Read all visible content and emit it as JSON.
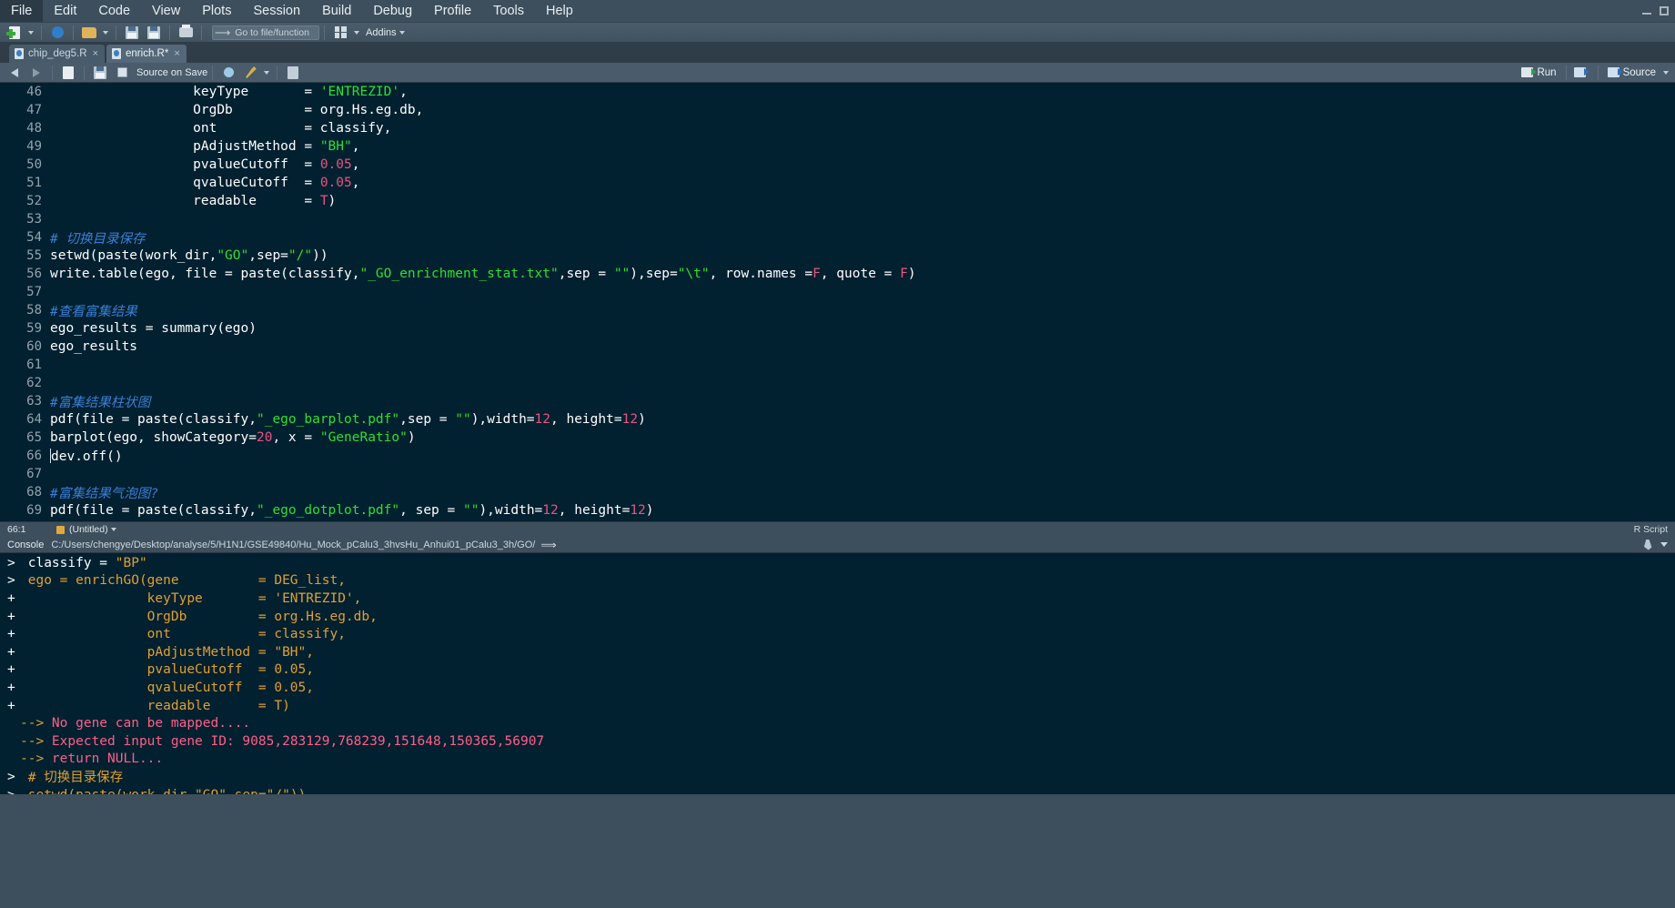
{
  "menubar": {
    "items": [
      {
        "label": "File",
        "active": true
      },
      {
        "label": "Edit",
        "active": false
      },
      {
        "label": "Code",
        "active": false
      },
      {
        "label": "View",
        "active": false
      },
      {
        "label": "Plots",
        "active": false
      },
      {
        "label": "Session",
        "active": false
      },
      {
        "label": "Build",
        "active": false
      },
      {
        "label": "Debug",
        "active": false
      },
      {
        "label": "Profile",
        "active": false
      },
      {
        "label": "Tools",
        "active": false
      },
      {
        "label": "Help",
        "active": false
      }
    ]
  },
  "global_toolbar": {
    "goto_placeholder": "Go to file/function",
    "addins_label": "Addins",
    "icons": [
      "new-file-icon",
      "new-project-icon",
      "open-file-icon",
      "save-icon",
      "save-all-icon",
      "print-icon",
      "workspace-panes-icon"
    ]
  },
  "source_tabs": [
    {
      "label": "chip_deg5.R",
      "active": false,
      "close": "×"
    },
    {
      "label": "enrich.R*",
      "active": true,
      "close": "×"
    }
  ],
  "editor_toolbar": {
    "source_on_save_label": "Source on Save",
    "run_label": "Run",
    "source_label": "Source"
  },
  "editor": {
    "lines": [
      {
        "num": "46",
        "segments": [
          {
            "t": "                  keyType       = ",
            "c": "plain"
          },
          {
            "t": "'ENTREZID'",
            "c": "str"
          },
          {
            "t": ",",
            "c": "plain"
          }
        ]
      },
      {
        "num": "47",
        "segments": [
          {
            "t": "                  OrgDb         = org.Hs.eg.db,",
            "c": "plain"
          }
        ]
      },
      {
        "num": "48",
        "segments": [
          {
            "t": "                  ont           = classify,",
            "c": "plain"
          }
        ]
      },
      {
        "num": "49",
        "segments": [
          {
            "t": "                  pAdjustMethod = ",
            "c": "plain"
          },
          {
            "t": "\"BH\"",
            "c": "str"
          },
          {
            "t": ",",
            "c": "plain"
          }
        ]
      },
      {
        "num": "50",
        "segments": [
          {
            "t": "                  pvalueCutoff  = ",
            "c": "plain"
          },
          {
            "t": "0.05",
            "c": "num"
          },
          {
            "t": ",",
            "c": "plain"
          }
        ]
      },
      {
        "num": "51",
        "segments": [
          {
            "t": "                  qvalueCutoff  = ",
            "c": "plain"
          },
          {
            "t": "0.05",
            "c": "num"
          },
          {
            "t": ",",
            "c": "plain"
          }
        ]
      },
      {
        "num": "52",
        "segments": [
          {
            "t": "                  readable      = ",
            "c": "plain"
          },
          {
            "t": "T",
            "c": "const"
          },
          {
            "t": ")",
            "c": "plain"
          }
        ]
      },
      {
        "num": "53",
        "segments": []
      },
      {
        "num": "54",
        "segments": [
          {
            "t": "# 切换目录保存",
            "c": "cmt"
          }
        ]
      },
      {
        "num": "55",
        "segments": [
          {
            "t": "setwd(paste(work_dir,",
            "c": "plain"
          },
          {
            "t": "\"GO\"",
            "c": "str"
          },
          {
            "t": ",sep=",
            "c": "plain"
          },
          {
            "t": "\"/\"",
            "c": "str"
          },
          {
            "t": "))",
            "c": "plain"
          }
        ]
      },
      {
        "num": "56",
        "segments": [
          {
            "t": "write.table(ego, file = paste(classify,",
            "c": "plain"
          },
          {
            "t": "\"_GO_enrichment_stat.txt\"",
            "c": "str"
          },
          {
            "t": ",sep = ",
            "c": "plain"
          },
          {
            "t": "\"\"",
            "c": "str"
          },
          {
            "t": "),sep=",
            "c": "plain"
          },
          {
            "t": "\"\\t\"",
            "c": "str"
          },
          {
            "t": ", row.names =",
            "c": "plain"
          },
          {
            "t": "F",
            "c": "const"
          },
          {
            "t": ", quote = ",
            "c": "plain"
          },
          {
            "t": "F",
            "c": "const"
          },
          {
            "t": ")",
            "c": "plain"
          }
        ]
      },
      {
        "num": "57",
        "segments": []
      },
      {
        "num": "58",
        "segments": [
          {
            "t": "#查看富集结果",
            "c": "cmt"
          }
        ]
      },
      {
        "num": "59",
        "segments": [
          {
            "t": "ego_results = summary(ego)",
            "c": "plain"
          }
        ]
      },
      {
        "num": "60",
        "segments": [
          {
            "t": "ego_results",
            "c": "plain"
          }
        ]
      },
      {
        "num": "61",
        "segments": []
      },
      {
        "num": "62",
        "segments": []
      },
      {
        "num": "63",
        "segments": [
          {
            "t": "#富集结果柱状图",
            "c": "cmt"
          }
        ]
      },
      {
        "num": "64",
        "segments": [
          {
            "t": "pdf(file = paste(classify,",
            "c": "plain"
          },
          {
            "t": "\"_ego_barplot.pdf\"",
            "c": "str"
          },
          {
            "t": ",sep = ",
            "c": "plain"
          },
          {
            "t": "\"\"",
            "c": "str"
          },
          {
            "t": "),width=",
            "c": "plain"
          },
          {
            "t": "12",
            "c": "num"
          },
          {
            "t": ", height=",
            "c": "plain"
          },
          {
            "t": "12",
            "c": "num"
          },
          {
            "t": ")",
            "c": "plain"
          }
        ]
      },
      {
        "num": "65",
        "segments": [
          {
            "t": "barplot(ego, showCategory=",
            "c": "plain"
          },
          {
            "t": "20",
            "c": "num"
          },
          {
            "t": ", x = ",
            "c": "plain"
          },
          {
            "t": "\"GeneRatio\"",
            "c": "str"
          },
          {
            "t": ")",
            "c": "plain"
          }
        ]
      },
      {
        "num": "66",
        "segments": [
          {
            "t": "dev.off()",
            "c": "plain"
          }
        ],
        "caret": true
      },
      {
        "num": "67",
        "segments": []
      },
      {
        "num": "68",
        "segments": [
          {
            "t": "#富集结果气泡图?",
            "c": "cmt"
          }
        ]
      },
      {
        "num": "69",
        "segments": [
          {
            "t": "pdf(file = paste(classify,",
            "c": "plain"
          },
          {
            "t": "\"_ego_dotplot.pdf\"",
            "c": "str"
          },
          {
            "t": ", sep = ",
            "c": "plain"
          },
          {
            "t": "\"\"",
            "c": "str"
          },
          {
            "t": "),width=",
            "c": "plain"
          },
          {
            "t": "12",
            "c": "num"
          },
          {
            "t": ", height=",
            "c": "plain"
          },
          {
            "t": "12",
            "c": "num"
          },
          {
            "t": ")",
            "c": "plain"
          }
        ]
      }
    ]
  },
  "editor_status": {
    "cursor_position": "66:1",
    "scope": "(Untitled)",
    "file_type": "R Script"
  },
  "console_header": {
    "title": "Console",
    "path": "C:/Users/chengye/Desktop/analyse/5/H1N1/GSE49840/Hu_Mock_pCalu3_3hvsHu_Anhui01_pCalu3_3h/GO/"
  },
  "console": {
    "lines": [
      {
        "prompt": ">",
        "segments": [
          {
            "t": " classify = ",
            "c": "white"
          },
          {
            "t": "\"BP\"",
            "c": "out"
          }
        ]
      },
      {
        "prompt": ">",
        "segments": [
          {
            "t": " ego = enrichGO(gene          = DEG_list,",
            "c": "out"
          }
        ]
      },
      {
        "prompt": "+",
        "segments": [
          {
            "t": "                keyType       = 'ENTREZID',",
            "c": "out"
          }
        ]
      },
      {
        "prompt": "+",
        "segments": [
          {
            "t": "                OrgDb         = org.Hs.eg.db,",
            "c": "out"
          }
        ]
      },
      {
        "prompt": "+",
        "segments": [
          {
            "t": "                ont           = classify,",
            "c": "out"
          }
        ]
      },
      {
        "prompt": "+",
        "segments": [
          {
            "t": "                pAdjustMethod = \"BH\",",
            "c": "out"
          }
        ]
      },
      {
        "prompt": "+",
        "segments": [
          {
            "t": "                pvalueCutoff  = 0.05,",
            "c": "out"
          }
        ]
      },
      {
        "prompt": "+",
        "segments": [
          {
            "t": "                qvalueCutoff  = 0.05,",
            "c": "out"
          }
        ]
      },
      {
        "prompt": "+",
        "segments": [
          {
            "t": "                readable      = T)",
            "c": "out"
          }
        ]
      },
      {
        "prompt": "",
        "segments": [
          {
            "t": "--> ",
            "c": "arrow"
          },
          {
            "t": "No gene can be mapped....",
            "c": "err"
          }
        ]
      },
      {
        "prompt": "",
        "segments": [
          {
            "t": "--> ",
            "c": "arrow"
          },
          {
            "t": "Expected input gene ID: 9085,283129,768239,151648,150365,56907",
            "c": "err"
          }
        ]
      },
      {
        "prompt": "",
        "segments": [
          {
            "t": "--> ",
            "c": "arrow"
          },
          {
            "t": "return NULL...",
            "c": "err"
          }
        ]
      },
      {
        "prompt": ">",
        "segments": [
          {
            "t": " # 切换目录保存",
            "c": "out"
          }
        ]
      },
      {
        "prompt": ">",
        "segments": [
          {
            "t": " setwd(paste(work_dir,\"GO\",sep=\"/\"))",
            "c": "out"
          }
        ]
      }
    ]
  }
}
